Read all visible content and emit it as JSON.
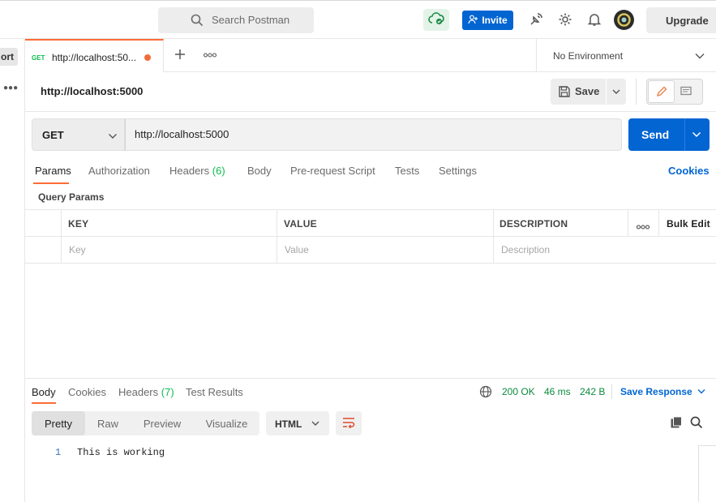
{
  "topbar": {
    "search_placeholder": "Search Postman",
    "invite_label": "Invite",
    "upgrade_label": "Upgrade"
  },
  "sidebar": {
    "import_label": "ort"
  },
  "tabs": {
    "active": {
      "method": "GET",
      "url": "http://localhost:50..."
    }
  },
  "environment": {
    "selected": "No Environment"
  },
  "request": {
    "title": "http://localhost:5000",
    "save_label": "Save",
    "method": "GET",
    "url": "http://localhost:5000",
    "send_label": "Send",
    "tabs": [
      {
        "label": "Params"
      },
      {
        "label": "Authorization"
      },
      {
        "label": "Headers",
        "count": "(6)"
      },
      {
        "label": "Body"
      },
      {
        "label": "Pre-request Script"
      },
      {
        "label": "Tests"
      },
      {
        "label": "Settings"
      }
    ],
    "cookies_label": "Cookies",
    "query_params_label": "Query Params",
    "table": {
      "headers": [
        "KEY",
        "VALUE",
        "DESCRIPTION"
      ],
      "bulk_edit_label": "Bulk Edit",
      "placeholders": {
        "key": "Key",
        "value": "Value",
        "description": "Description"
      }
    }
  },
  "response": {
    "tabs": [
      {
        "label": "Body"
      },
      {
        "label": "Cookies"
      },
      {
        "label": "Headers",
        "count": "(7)"
      },
      {
        "label": "Test Results"
      }
    ],
    "status": "200 OK",
    "time": "46 ms",
    "size": "242 B",
    "save_response_label": "Save Response",
    "view_modes": [
      "Pretty",
      "Raw",
      "Preview",
      "Visualize"
    ],
    "format": "HTML",
    "line_number": "1",
    "body_text": "This is working"
  },
  "colors": {
    "brand_orange": "#ff6c37",
    "primary_blue": "#0265d2",
    "success_green": "#0cbb52"
  }
}
